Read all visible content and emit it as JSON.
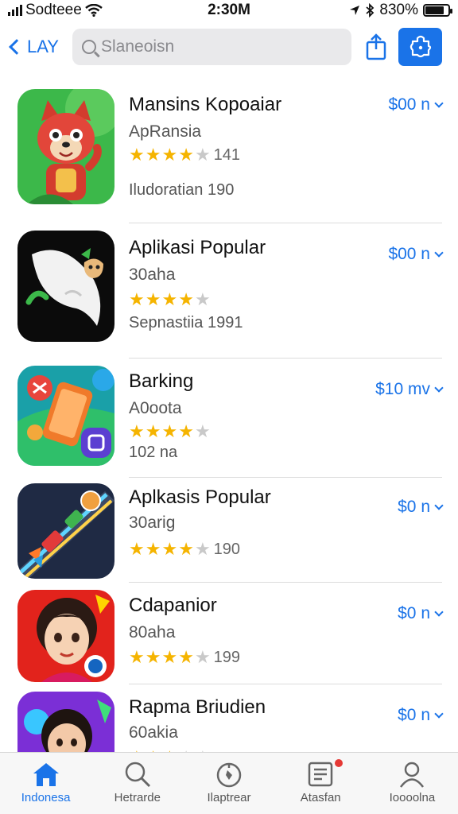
{
  "status_bar": {
    "carrier": "Sodteee",
    "time": "2:30M",
    "battery": "830%",
    "battery_level": 0.83
  },
  "nav": {
    "back_label": "LAY",
    "search_placeholder": "Slaneoisn"
  },
  "apps": [
    {
      "name": "Mansins Kopoaiar",
      "subtitle": "ApRansia",
      "rating": 4,
      "rating_count": "141",
      "meta": "Iludoratian   190",
      "price": "$00 n"
    },
    {
      "name": "Aplikasi Popular",
      "subtitle": "30aha",
      "rating": 4,
      "rating_count": "",
      "meta": "Sepnastiia   1991",
      "price": "$00 n"
    },
    {
      "name": "Barking",
      "subtitle": "A0oota",
      "rating": 4,
      "rating_count": "",
      "meta": "102 na",
      "price": "$10 mv"
    },
    {
      "name": "Aplkasis Popular",
      "subtitle": "30arig",
      "rating": 3.5,
      "rating_count": "190",
      "meta": "",
      "price": "$0 n"
    },
    {
      "name": "Cdapanior",
      "subtitle": "80aha",
      "rating": 3.5,
      "rating_count": "199",
      "meta": "",
      "price": "$0 n"
    },
    {
      "name": "Rapma Briudien",
      "subtitle": "60akia",
      "rating": 3,
      "rating_count": "",
      "meta": "",
      "price": "$0 n"
    }
  ],
  "tabs": [
    {
      "label": "Indonesa",
      "icon": "home-icon",
      "active": true
    },
    {
      "label": "Hetrarde",
      "icon": "search-icon",
      "active": false
    },
    {
      "label": "Ilaptrear",
      "icon": "compass-icon",
      "active": false
    },
    {
      "label": "Atasfan",
      "icon": "news-icon",
      "active": false,
      "badge": true
    },
    {
      "label": "Ioooolna",
      "icon": "person-icon",
      "active": false
    }
  ],
  "colors": {
    "accent": "#1a73e8",
    "star": "#f5b400",
    "badge": "#e53935"
  }
}
